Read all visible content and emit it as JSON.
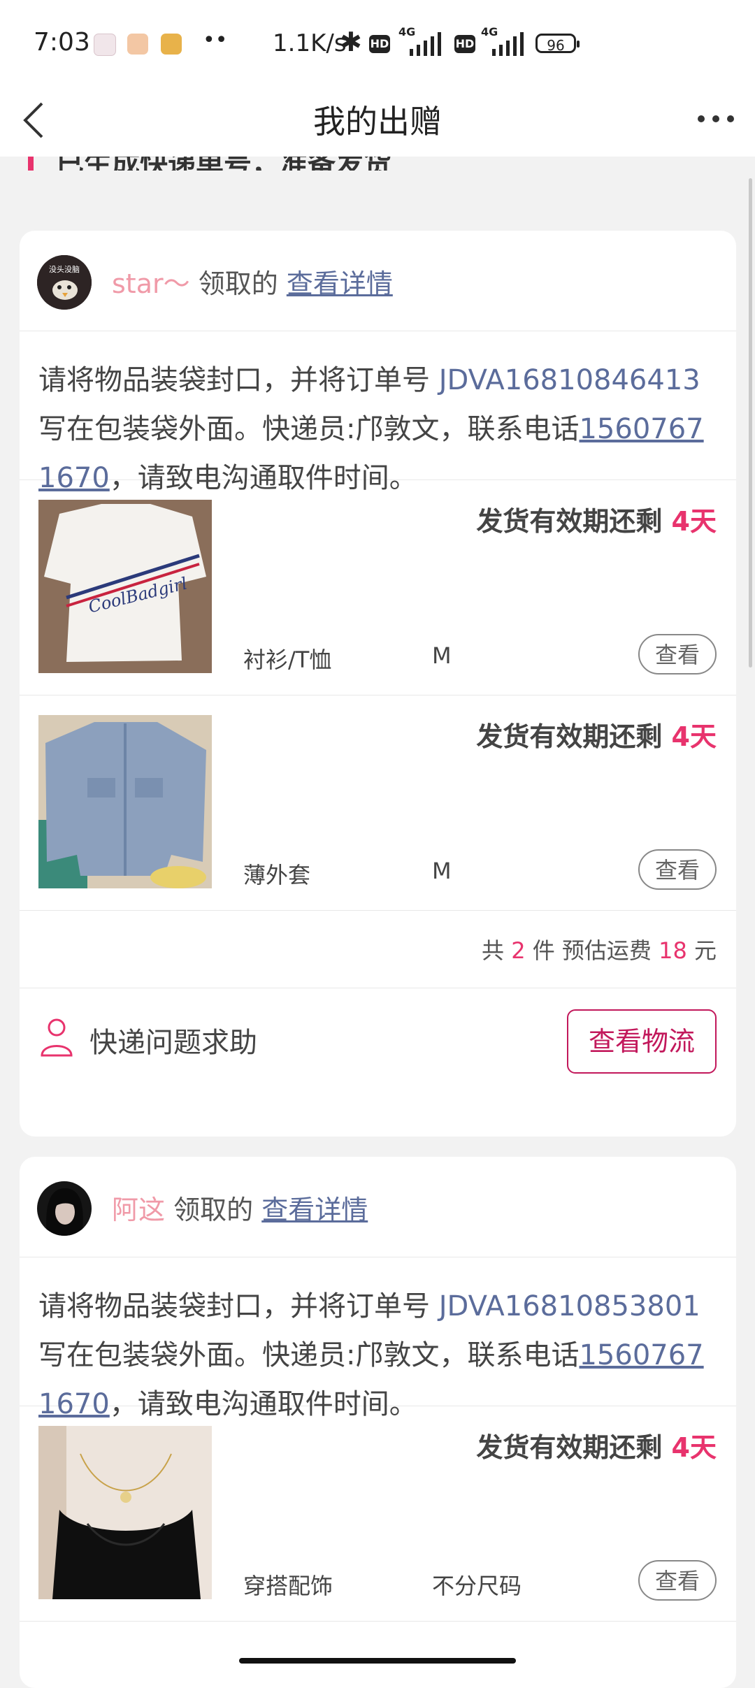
{
  "status_bar": {
    "time": "7:03",
    "net_speed": "1.1K/s",
    "hd": "HD",
    "network": "4G",
    "battery": "96"
  },
  "nav": {
    "title": "我的出赠"
  },
  "banner": {
    "text": "已生成快递单号，准备发货"
  },
  "cards": [
    {
      "avatar_text": "没头没脑",
      "user": "star～",
      "taken_label": "领取的",
      "detail_link": "查看详情",
      "instruction_prefix": "请将物品装袋封口，并将订单号 ",
      "order_no": "JDVA16810846413",
      "instruction_mid": " 写在包装袋外面。快递员:邝敦文，联系电话",
      "phone": "15607671670",
      "instruction_suffix": "，请致电沟通取件时间。",
      "items": [
        {
          "deadline_label": "发货有效期还剩 ",
          "days": "4天",
          "category": "衬衫/T恤",
          "size": "M",
          "view_label": "查看",
          "thumb_text": "CoolBadgirl"
        },
        {
          "deadline_label": "发货有效期还剩 ",
          "days": "4天",
          "category": "薄外套",
          "size": "M",
          "view_label": "查看"
        }
      ],
      "summary": {
        "pre": "共 ",
        "count": "2",
        "mid": " 件 预估运费 ",
        "fee": "18",
        "post": " 元"
      },
      "help_label": "快递问题求助",
      "logistics_label": "查看物流"
    },
    {
      "user": "阿这",
      "taken_label": "领取的",
      "detail_link": "查看详情",
      "instruction_prefix": "请将物品装袋封口，并将订单号 ",
      "order_no": "JDVA16810853801",
      "instruction_mid": " 写在包装袋外面。快递员:邝敦文，联系电话",
      "phone": "15607671670",
      "instruction_suffix": "，请致电沟通取件时间。",
      "items": [
        {
          "deadline_label": "发货有效期还剩 ",
          "days": "4天",
          "category": "穿搭配饰",
          "size": "不分尺码",
          "view_label": "查看"
        }
      ]
    }
  ],
  "colors": {
    "accent": "#e8336d",
    "link": "#5b6c9b",
    "username": "#f09aa8",
    "logistics": "#c2185b"
  }
}
